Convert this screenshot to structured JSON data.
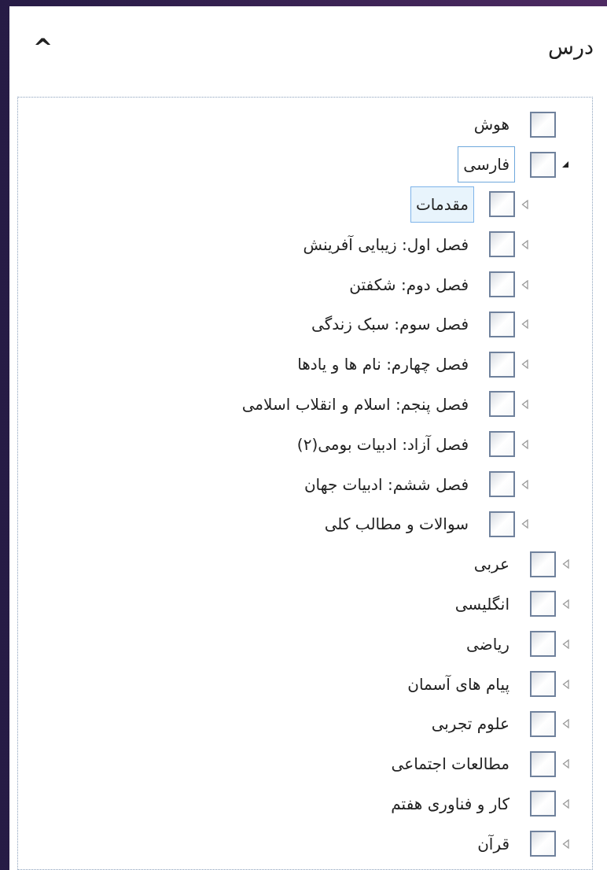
{
  "panel": {
    "title": "درس",
    "collapse_icon": "^"
  },
  "tree": [
    {
      "label": "هوش",
      "expandable": false,
      "checked": false,
      "selected": false,
      "focused": false
    },
    {
      "label": "فارسی",
      "expandable": true,
      "expanded": true,
      "checked": false,
      "selected": false,
      "focused": true,
      "children": [
        {
          "label": "مقدمات",
          "expandable": true,
          "expanded": false,
          "checked": false,
          "selected": true,
          "focused": false
        },
        {
          "label": "فصل اول: زیبایی آفرینش",
          "expandable": true,
          "expanded": false,
          "checked": false,
          "selected": false,
          "focused": false
        },
        {
          "label": "فصل دوم: شکفتن",
          "expandable": true,
          "expanded": false,
          "checked": false,
          "selected": false,
          "focused": false
        },
        {
          "label": "فصل سوم: سبک زندگی",
          "expandable": true,
          "expanded": false,
          "checked": false,
          "selected": false,
          "focused": false
        },
        {
          "label": "فصل چهارم: نام ها و یادها",
          "expandable": true,
          "expanded": false,
          "checked": false,
          "selected": false,
          "focused": false
        },
        {
          "label": "فصل پنجم: اسلام و انقلاب اسلامی",
          "expandable": true,
          "expanded": false,
          "checked": false,
          "selected": false,
          "focused": false
        },
        {
          "label": "فصل آزاد: ادبیات بومی(۲)",
          "expandable": true,
          "expanded": false,
          "checked": false,
          "selected": false,
          "focused": false
        },
        {
          "label": "فصل ششم: ادبیات جهان",
          "expandable": true,
          "expanded": false,
          "checked": false,
          "selected": false,
          "focused": false
        },
        {
          "label": "سوالات و مطالب کلی",
          "expandable": true,
          "expanded": false,
          "checked": false,
          "selected": false,
          "focused": false
        }
      ]
    },
    {
      "label": "عربی",
      "expandable": true,
      "expanded": false,
      "checked": false,
      "selected": false,
      "focused": false
    },
    {
      "label": "انگلیسی",
      "expandable": true,
      "expanded": false,
      "checked": false,
      "selected": false,
      "focused": false
    },
    {
      "label": "ریاضی",
      "expandable": true,
      "expanded": false,
      "checked": false,
      "selected": false,
      "focused": false
    },
    {
      "label": "پیام های آسمان",
      "expandable": true,
      "expanded": false,
      "checked": false,
      "selected": false,
      "focused": false
    },
    {
      "label": "علوم تجربی",
      "expandable": true,
      "expanded": false,
      "checked": false,
      "selected": false,
      "focused": false
    },
    {
      "label": "مطالعات اجتماعی",
      "expandable": true,
      "expanded": false,
      "checked": false,
      "selected": false,
      "focused": false
    },
    {
      "label": "کار و فناوری هفتم",
      "expandable": true,
      "expanded": false,
      "checked": false,
      "selected": false,
      "focused": false
    },
    {
      "label": "قرآن",
      "expandable": true,
      "expanded": false,
      "checked": false,
      "selected": false,
      "focused": false
    }
  ]
}
